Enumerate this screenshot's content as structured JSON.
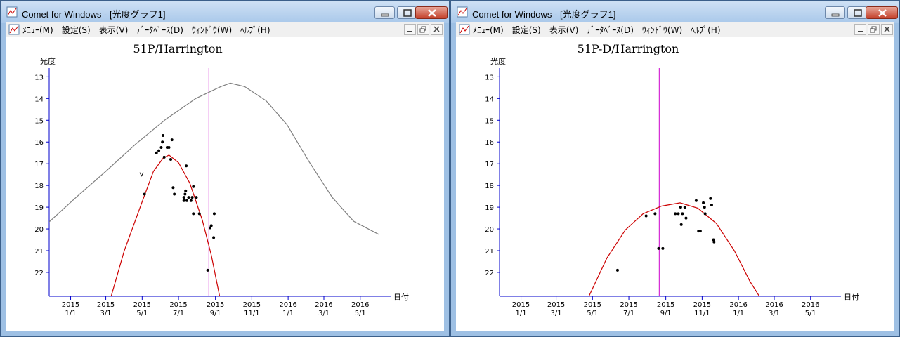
{
  "windows": [
    {
      "title": "Comet for Windows - [光度グラフ1]",
      "menu": [
        "ﾒﾆｭｰ(M)",
        "設定(S)",
        "表示(V)",
        "ﾃﾞｰﾀﾍﾞｰｽ(D)",
        "ｳｨﾝﾄﾞｳ(W)",
        "ﾍﾙﾌﾟ(H)"
      ],
      "chart": {
        "title": "51P/Harrington",
        "ylabel": "光度",
        "xlabel": "日付",
        "yticks": [
          "13",
          "14",
          "15",
          "16",
          "17",
          "18",
          "19",
          "20",
          "21",
          "22"
        ],
        "xticks": [
          [
            "2015",
            "1/1"
          ],
          [
            "2015",
            "3/1"
          ],
          [
            "2015",
            "5/1"
          ],
          [
            "2015",
            "7/1"
          ],
          [
            "2015",
            "9/1"
          ],
          [
            "2015",
            "11/1"
          ],
          [
            "2016",
            "1/1"
          ],
          [
            "2016",
            "3/1"
          ],
          [
            "2016",
            "5/1"
          ]
        ]
      }
    },
    {
      "title": "Comet for Windows - [光度グラフ1]",
      "menu": [
        "ﾒﾆｭｰ(M)",
        "設定(S)",
        "表示(V)",
        "ﾃﾞｰﾀﾍﾞｰｽ(D)",
        "ｳｨﾝﾄﾞｳ(W)",
        "ﾍﾙﾌﾟ(H)"
      ],
      "chart": {
        "title": "51P-D/Harrington",
        "ylabel": "光度",
        "xlabel": "日付",
        "yticks": [
          "13",
          "14",
          "15",
          "16",
          "17",
          "18",
          "19",
          "20",
          "21",
          "22"
        ],
        "xticks": [
          [
            "2015",
            "1/1"
          ],
          [
            "2015",
            "3/1"
          ],
          [
            "2015",
            "5/1"
          ],
          [
            "2015",
            "7/1"
          ],
          [
            "2015",
            "9/1"
          ],
          [
            "2015",
            "11/1"
          ],
          [
            "2016",
            "1/1"
          ],
          [
            "2016",
            "3/1"
          ],
          [
            "2016",
            "5/1"
          ]
        ]
      }
    }
  ],
  "chart_data": [
    {
      "type": "scatter",
      "title": "51P/Harrington",
      "xlabel": "日付",
      "ylabel": "光度",
      "x_range": [
        "2014-11-26",
        "2016-06-21"
      ],
      "ylim": [
        12.6,
        23.1
      ],
      "y_inverted": true,
      "grid": false,
      "vertical_marker": {
        "date": "2015-08-21",
        "color": "#cc00cc"
      },
      "series": [
        {
          "color": "#808080",
          "points": [
            [
              "2014-11-26",
              19.68
            ],
            [
              "2015-01-10",
              18.55
            ],
            [
              "2015-03-01",
              17.35
            ],
            [
              "2015-04-20",
              16.1
            ],
            [
              "2015-06-10",
              14.95
            ],
            [
              "2015-07-30",
              14.0
            ],
            [
              "2015-09-10",
              13.45
            ],
            [
              "2015-09-26",
              13.29
            ],
            [
              "2015-10-20",
              13.45
            ],
            [
              "2015-11-25",
              14.1
            ],
            [
              "2015-12-30",
              15.2
            ],
            [
              "2016-02-05",
              16.9
            ],
            [
              "2016-03-15",
              18.55
            ],
            [
              "2016-04-20",
              19.65
            ],
            [
              "2016-06-01",
              20.25
            ]
          ]
        },
        {
          "color": "#cc0000",
          "points": [
            [
              "2015-03-10",
              23.1
            ],
            [
              "2015-04-01",
              21.0
            ],
            [
              "2015-05-01",
              18.75
            ],
            [
              "2015-05-20",
              17.35
            ],
            [
              "2015-06-05",
              16.75
            ],
            [
              "2015-06-15",
              16.6
            ],
            [
              "2015-07-01",
              16.95
            ],
            [
              "2015-07-20",
              17.9
            ],
            [
              "2015-08-10",
              19.6
            ],
            [
              "2015-08-25",
              21.2
            ],
            [
              "2015-09-08",
              23.1
            ]
          ]
        },
        {
          "color": "#000000",
          "points": [
            [
              "2015-05-05",
              18.4
            ],
            [
              "2015-05-25",
              16.5
            ],
            [
              "2015-05-29",
              16.4
            ],
            [
              "2015-06-02",
              16.25
            ],
            [
              "2015-06-04",
              16.0
            ],
            [
              "2015-06-05",
              15.7
            ],
            [
              "2015-06-07",
              16.7
            ],
            [
              "2015-06-12",
              16.25
            ],
            [
              "2015-06-15",
              16.25
            ],
            [
              "2015-06-18",
              16.8
            ],
            [
              "2015-06-20",
              15.9
            ],
            [
              "2015-06-22",
              18.1
            ],
            [
              "2015-06-24",
              18.4
            ],
            [
              "2015-07-10",
              18.55
            ],
            [
              "2015-07-10",
              18.7
            ],
            [
              "2015-07-12",
              18.4
            ],
            [
              "2015-07-13",
              18.25
            ],
            [
              "2015-07-14",
              17.1
            ],
            [
              "2015-07-15",
              18.7
            ],
            [
              "2015-07-18",
              18.55
            ],
            [
              "2015-07-22",
              18.7
            ],
            [
              "2015-07-24",
              18.55
            ],
            [
              "2015-07-26",
              19.3
            ],
            [
              "2015-07-26",
              18.05
            ],
            [
              "2015-07-31",
              18.55
            ],
            [
              "2015-08-05",
              19.3
            ],
            [
              "2015-08-19",
              21.9
            ],
            [
              "2015-08-23",
              19.95
            ],
            [
              "2015-08-25",
              19.85
            ],
            [
              "2015-08-29",
              20.4
            ],
            [
              "2015-08-30",
              19.3
            ]
          ]
        },
        {
          "color": "#000000",
          "marker": "v",
          "points": [
            [
              "2015-04-30",
              17.5
            ]
          ]
        }
      ]
    },
    {
      "type": "scatter",
      "title": "51P-D/Harrington",
      "xlabel": "日付",
      "ylabel": "光度",
      "x_range": [
        "2014-11-26",
        "2016-06-21"
      ],
      "ylim": [
        12.6,
        23.1
      ],
      "y_inverted": true,
      "grid": false,
      "vertical_marker": {
        "date": "2015-08-21",
        "color": "#cc00cc"
      },
      "series": [
        {
          "color": "#cc0000",
          "points": [
            [
              "2015-04-25",
              23.1
            ],
            [
              "2015-05-25",
              21.35
            ],
            [
              "2015-06-25",
              20.05
            ],
            [
              "2015-07-25",
              19.3
            ],
            [
              "2015-08-25",
              18.95
            ],
            [
              "2015-09-25",
              18.8
            ],
            [
              "2015-10-25",
              19.05
            ],
            [
              "2015-11-25",
              19.75
            ],
            [
              "2015-12-25",
              21.0
            ],
            [
              "2016-01-20",
              22.4
            ],
            [
              "2016-02-05",
              23.1
            ]
          ]
        },
        {
          "color": "#000000",
          "points": [
            [
              "2015-06-12",
              21.9
            ],
            [
              "2015-07-30",
              19.4
            ],
            [
              "2015-08-14",
              19.3
            ],
            [
              "2015-08-20",
              20.9
            ],
            [
              "2015-08-27",
              20.9
            ],
            [
              "2015-09-17",
              19.3
            ],
            [
              "2015-09-22",
              19.3
            ],
            [
              "2015-09-26",
              19.0
            ],
            [
              "2015-09-27",
              19.8
            ],
            [
              "2015-09-29",
              19.3
            ],
            [
              "2015-10-03",
              19.0
            ],
            [
              "2015-10-05",
              19.5
            ],
            [
              "2015-10-22",
              18.7
            ],
            [
              "2015-10-26",
              20.1
            ],
            [
              "2015-10-29",
              20.1
            ],
            [
              "2015-11-03",
              18.8
            ],
            [
              "2015-11-05",
              19.0
            ],
            [
              "2015-11-06",
              19.3
            ],
            [
              "2015-11-15",
              18.6
            ],
            [
              "2015-11-17",
              18.9
            ],
            [
              "2015-11-20",
              20.5
            ],
            [
              "2015-11-21",
              20.6
            ]
          ]
        }
      ]
    }
  ]
}
